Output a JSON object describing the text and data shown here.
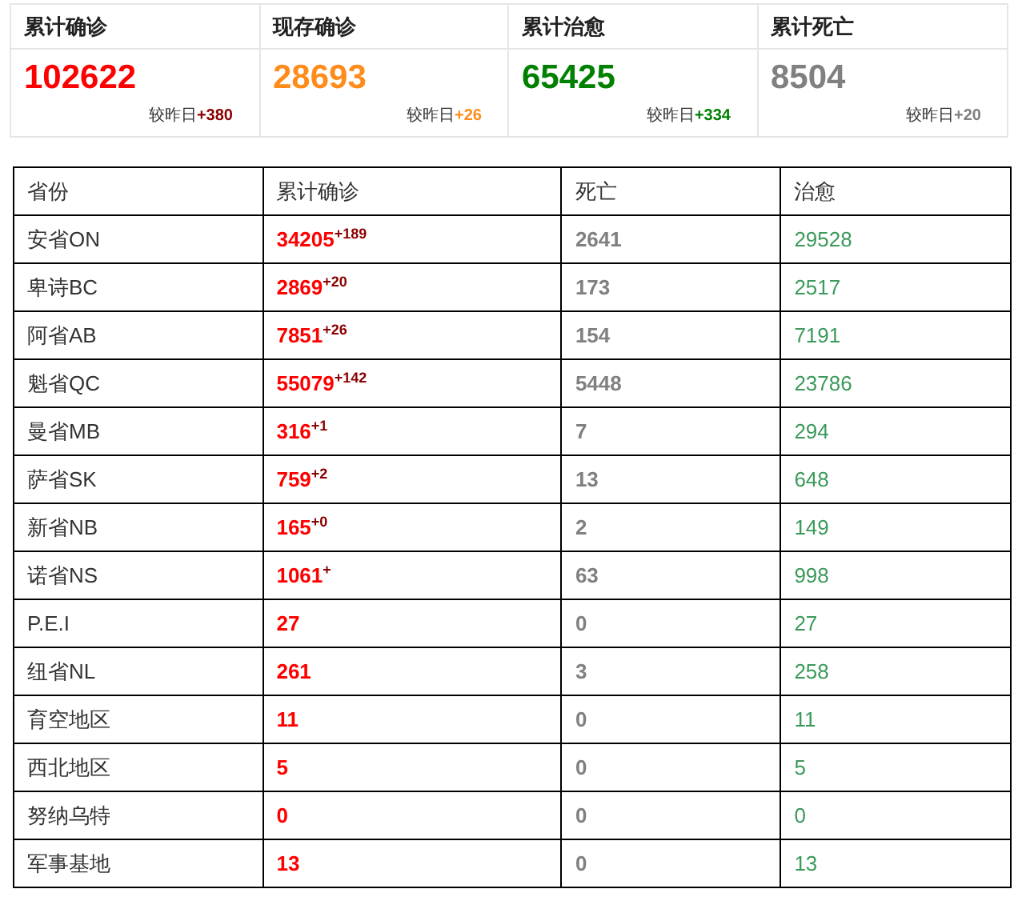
{
  "summary": [
    {
      "label": "累计确诊",
      "value": "102622",
      "change_label": "较昨日",
      "change": "+380",
      "kind": "confirmed"
    },
    {
      "label": "现存确诊",
      "value": "28693",
      "change_label": "较昨日",
      "change": "+26",
      "kind": "active"
    },
    {
      "label": "累计治愈",
      "value": "65425",
      "change_label": "较昨日",
      "change": "+334",
      "kind": "recovered"
    },
    {
      "label": "累计死亡",
      "value": "8504",
      "change_label": "较昨日",
      "change": "+20",
      "kind": "deaths"
    }
  ],
  "table": {
    "columns": [
      "省份",
      "累计确诊",
      "死亡",
      "治愈"
    ],
    "rows": [
      {
        "province": "安省ON",
        "confirmed": "34205",
        "increase": "+189",
        "deaths": "2641",
        "recovered": "29528"
      },
      {
        "province": "卑诗BC",
        "confirmed": "2869",
        "increase": "+20",
        "deaths": "173",
        "recovered": "2517"
      },
      {
        "province": "阿省AB",
        "confirmed": "7851",
        "increase": "+26",
        "deaths": "154",
        "recovered": "7191"
      },
      {
        "province": "魁省QC",
        "confirmed": "55079",
        "increase": "+142",
        "deaths": "5448",
        "recovered": "23786"
      },
      {
        "province": "曼省MB",
        "confirmed": "316",
        "increase": "+1",
        "deaths": "7",
        "recovered": "294"
      },
      {
        "province": "萨省SK",
        "confirmed": "759",
        "increase": "+2",
        "deaths": "13",
        "recovered": "648"
      },
      {
        "province": "新省NB",
        "confirmed": "165",
        "increase": "+0",
        "deaths": "2",
        "recovered": "149"
      },
      {
        "province": "诺省NS",
        "confirmed": "1061",
        "increase": "+",
        "deaths": "63",
        "recovered": "998"
      },
      {
        "province": "P.E.I",
        "confirmed": "27",
        "deaths": "0",
        "recovered": "27"
      },
      {
        "province": "纽省NL",
        "confirmed": "261",
        "deaths": "3",
        "recovered": "258"
      },
      {
        "province": "育空地区",
        "confirmed": "11",
        "deaths": "0",
        "recovered": "11"
      },
      {
        "province": "西北地区",
        "confirmed": "5",
        "deaths": "0",
        "recovered": "5"
      },
      {
        "province": "努纳乌特",
        "confirmed": "0",
        "deaths": "0",
        "recovered": "0"
      },
      {
        "province": "军事基地",
        "confirmed": "13",
        "deaths": "0",
        "recovered": "13"
      }
    ]
  }
}
